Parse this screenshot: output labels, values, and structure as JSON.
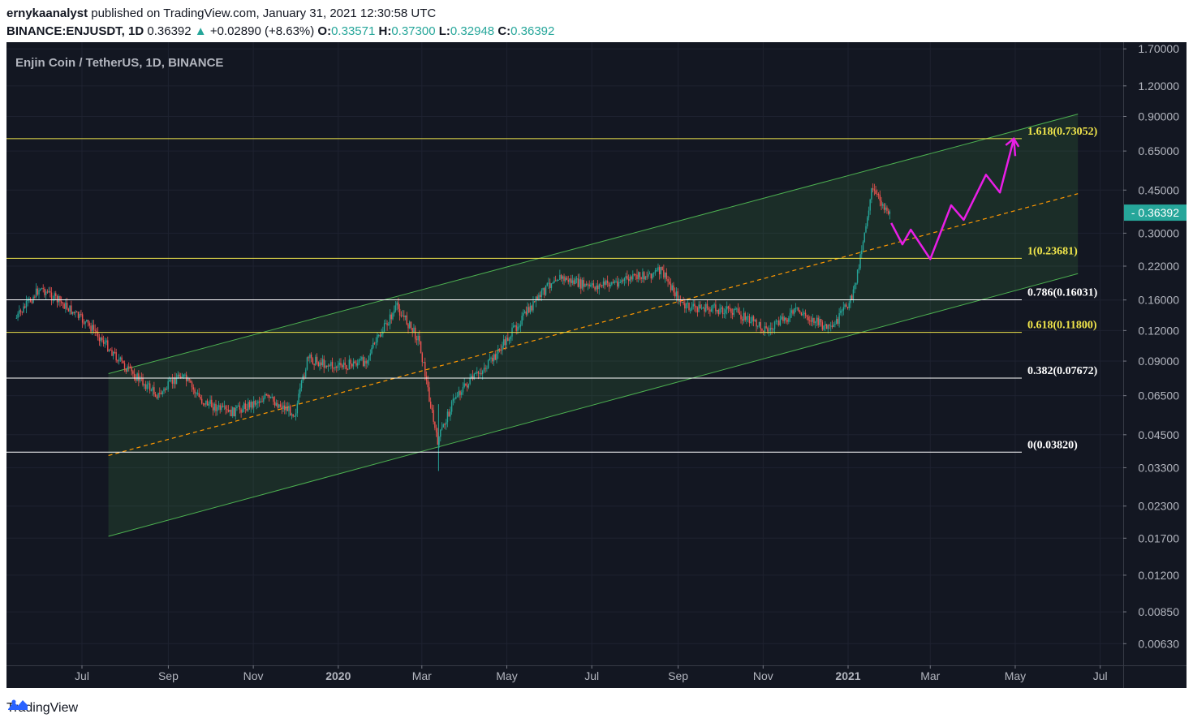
{
  "header": {
    "author": "ernykaanalyst",
    "published": "published on TradingView.com, January 31, 2021 12:30:58 UTC",
    "symbol": "BINANCE:ENJUSDT, 1D",
    "last": "0.36392",
    "change": "+0.02890 (+8.63%)",
    "o_label": "O:",
    "o": "0.33571",
    "h_label": "H:",
    "h": "0.37300",
    "l_label": "L:",
    "l": "0.32948",
    "c_label": "C:",
    "c": "0.36392"
  },
  "chart_title": "Enjin Coin / TetherUS, 1D, BINANCE",
  "footer": {
    "brand": "TradingView"
  },
  "colors": {
    "background": "#131722",
    "fib_yellow": "#f0e54b",
    "fib_white": "#ffffff",
    "channel": "#4caf50",
    "midline": "#ff9800",
    "projection": "#e91ee6",
    "up": "#26a69a",
    "down": "#ef5350"
  },
  "chart_data": {
    "type": "line",
    "scale": "log",
    "title": "Enjin Coin / TetherUS, 1D, BINANCE",
    "y_ticks": [
      "1.70000",
      "1.20000",
      "0.90000",
      "0.65000",
      "0.45000",
      "0.30000",
      "0.22000",
      "0.16000",
      "0.12000",
      "0.09000",
      "0.06500",
      "0.04500",
      "0.03300",
      "0.02300",
      "0.01700",
      "0.01200",
      "0.00850",
      "0.00630"
    ],
    "x_ticks": [
      "Jul",
      "Sep",
      "Nov",
      "2020",
      "Mar",
      "May",
      "Jul",
      "Sep",
      "Nov",
      "2021",
      "Mar",
      "May",
      "Jul"
    ],
    "x_ticks_bold": [
      "2020",
      "2021"
    ],
    "current_price_label": "0.36392",
    "fib_levels": [
      {
        "label": "1.618(0.73052)",
        "value": 0.73052,
        "color": "yellow"
      },
      {
        "label": "1(0.23681)",
        "value": 0.23681,
        "color": "yellow"
      },
      {
        "label": "0.786(0.16031)",
        "value": 0.16031,
        "color": "white"
      },
      {
        "label": "0.618(0.11800)",
        "value": 0.118,
        "color": "yellow"
      },
      {
        "label": "0.382(0.07672)",
        "value": 0.07672,
        "color": "white"
      },
      {
        "label": "0(0.03820)",
        "value": 0.0382,
        "color": "white"
      }
    ],
    "price_path": [
      {
        "date": "2019-05-15",
        "price": 0.135
      },
      {
        "date": "2019-06-01",
        "price": 0.18
      },
      {
        "date": "2019-06-20",
        "price": 0.15
      },
      {
        "date": "2019-07-10",
        "price": 0.12
      },
      {
        "date": "2019-08-01",
        "price": 0.085
      },
      {
        "date": "2019-08-25",
        "price": 0.065
      },
      {
        "date": "2019-09-10",
        "price": 0.08
      },
      {
        "date": "2019-09-25",
        "price": 0.062
      },
      {
        "date": "2019-10-15",
        "price": 0.055
      },
      {
        "date": "2019-11-10",
        "price": 0.064
      },
      {
        "date": "2019-12-01",
        "price": 0.055
      },
      {
        "date": "2019-12-10",
        "price": 0.092
      },
      {
        "date": "2019-12-31",
        "price": 0.085
      },
      {
        "date": "2020-01-20",
        "price": 0.09
      },
      {
        "date": "2020-02-12",
        "price": 0.15
      },
      {
        "date": "2020-02-28",
        "price": 0.11
      },
      {
        "date": "2020-03-12",
        "price": 0.042
      },
      {
        "date": "2020-03-25",
        "price": 0.065
      },
      {
        "date": "2020-04-20",
        "price": 0.09
      },
      {
        "date": "2020-05-10",
        "price": 0.13
      },
      {
        "date": "2020-06-05",
        "price": 0.2
      },
      {
        "date": "2020-06-30",
        "price": 0.18
      },
      {
        "date": "2020-07-20",
        "price": 0.19
      },
      {
        "date": "2020-08-20",
        "price": 0.21
      },
      {
        "date": "2020-09-05",
        "price": 0.15
      },
      {
        "date": "2020-10-10",
        "price": 0.145
      },
      {
        "date": "2020-11-05",
        "price": 0.12
      },
      {
        "date": "2020-11-25",
        "price": 0.145
      },
      {
        "date": "2020-12-20",
        "price": 0.12
      },
      {
        "date": "2021-01-05",
        "price": 0.17
      },
      {
        "date": "2021-01-18",
        "price": 0.45
      },
      {
        "date": "2021-01-31",
        "price": 0.36392
      }
    ],
    "channel": {
      "upper": [
        {
          "date": "2019-07-20",
          "price": 0.08
        },
        {
          "date": "2021-06-15",
          "price": 0.92
        }
      ],
      "lower": [
        {
          "date": "2019-07-20",
          "price": 0.0173
        },
        {
          "date": "2021-06-15",
          "price": 0.205
        }
      ],
      "middle": [
        {
          "date": "2019-07-20",
          "price": 0.037
        },
        {
          "date": "2021-06-15",
          "price": 0.435
        }
      ]
    },
    "projection": [
      {
        "date": "2021-02-01",
        "price": 0.33
      },
      {
        "date": "2021-02-09",
        "price": 0.27
      },
      {
        "date": "2021-02-15",
        "price": 0.31
      },
      {
        "date": "2021-03-01",
        "price": 0.235
      },
      {
        "date": "2021-03-16",
        "price": 0.39
      },
      {
        "date": "2021-03-25",
        "price": 0.34
      },
      {
        "date": "2021-04-10",
        "price": 0.52
      },
      {
        "date": "2021-04-20",
        "price": 0.44
      },
      {
        "date": "2021-04-30",
        "price": 0.73
      },
      {
        "date": "2021-05-01",
        "price": 0.62
      }
    ]
  }
}
